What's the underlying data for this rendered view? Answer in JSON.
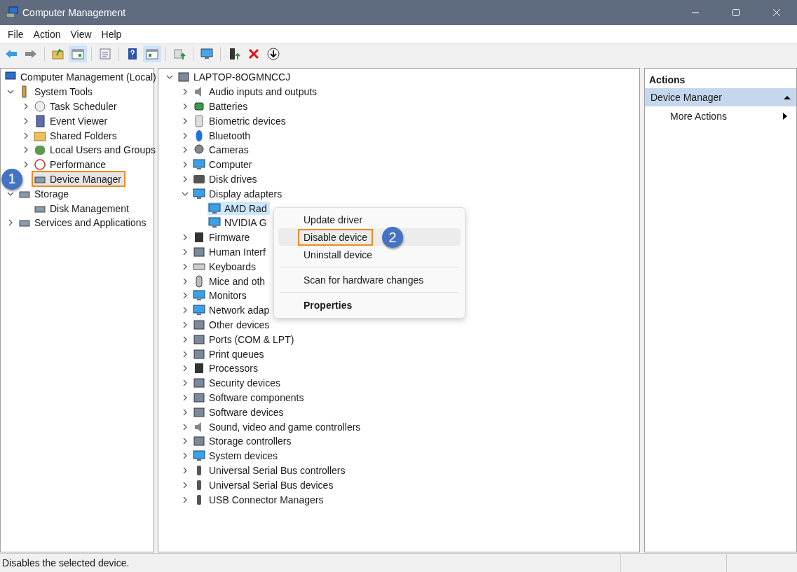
{
  "window": {
    "title": "Computer Management"
  },
  "menu_bar": [
    "File",
    "Action",
    "View",
    "Help"
  ],
  "toolbar": [
    {
      "pressed": false
    },
    {
      "pressed": false
    },
    {
      "pressed": false
    },
    {
      "pressed": true
    },
    {
      "pressed": false
    },
    {
      "pressed": false
    },
    {
      "pressed": true
    },
    {
      "pressed": false
    },
    {
      "pressed": false
    },
    {
      "pressed": false
    },
    {
      "pressed": false
    },
    {
      "pressed": false
    }
  ],
  "console_tree": {
    "root": {
      "label": "Computer Management (Local)",
      "selected": false,
      "children": [
        {
          "label": "System Tools",
          "selected": false,
          "expanded": true,
          "children": [
            {
              "label": "Task Scheduler",
              "selected": false,
              "expanded": false
            },
            {
              "label": "Event Viewer",
              "selected": false,
              "expanded": false
            },
            {
              "label": "Shared Folders",
              "selected": false,
              "expanded": false
            },
            {
              "label": "Local Users and Groups",
              "selected": false,
              "expanded": false
            },
            {
              "label": "Performance",
              "selected": false,
              "expanded": false
            },
            {
              "label": "Device Manager",
              "selected": true,
              "callout": "1"
            }
          ]
        },
        {
          "label": "Storage",
          "selected": false,
          "expanded": true,
          "children": [
            {
              "label": "Disk Management",
              "selected": false
            }
          ]
        },
        {
          "label": "Services and Applications",
          "selected": false,
          "expanded": false
        }
      ]
    }
  },
  "device_tree": {
    "root": {
      "label": "LAPTOP-8OGMNCCJ",
      "selected": false,
      "expanded": true,
      "children": [
        {
          "label": "Audio inputs and outputs",
          "selected": false,
          "expanded": false
        },
        {
          "label": "Batteries",
          "selected": false,
          "expanded": false
        },
        {
          "label": "Biometric devices",
          "selected": false,
          "expanded": false
        },
        {
          "label": "Bluetooth",
          "selected": false,
          "expanded": false
        },
        {
          "label": "Cameras",
          "selected": false,
          "expanded": false
        },
        {
          "label": "Computer",
          "selected": false,
          "expanded": false
        },
        {
          "label": "Disk drives",
          "selected": false,
          "expanded": false
        },
        {
          "label": "Display adapters",
          "selected": false,
          "expanded": true,
          "children": [
            {
              "label": "AMD Rad",
              "selected": true
            },
            {
              "label": "NVIDIA G",
              "selected": false
            }
          ]
        },
        {
          "label": "Firmware",
          "selected": false,
          "expanded": false
        },
        {
          "label": "Human Interf",
          "selected": false,
          "expanded": false
        },
        {
          "label": "Keyboards",
          "selected": false,
          "expanded": false
        },
        {
          "label": "Mice and oth",
          "selected": false,
          "expanded": false
        },
        {
          "label": "Monitors",
          "selected": false,
          "expanded": false
        },
        {
          "label": "Network adap",
          "selected": false,
          "expanded": false
        },
        {
          "label": "Other devices",
          "selected": false,
          "expanded": false
        },
        {
          "label": "Ports (COM & LPT)",
          "selected": false,
          "expanded": false
        },
        {
          "label": "Print queues",
          "selected": false,
          "expanded": false
        },
        {
          "label": "Processors",
          "selected": false,
          "expanded": false
        },
        {
          "label": "Security devices",
          "selected": false,
          "expanded": false
        },
        {
          "label": "Software components",
          "selected": false,
          "expanded": false
        },
        {
          "label": "Software devices",
          "selected": false,
          "expanded": false
        },
        {
          "label": "Sound, video and game controllers",
          "selected": false,
          "expanded": false
        },
        {
          "label": "Storage controllers",
          "selected": false,
          "expanded": false
        },
        {
          "label": "System devices",
          "selected": false,
          "expanded": false
        },
        {
          "label": "Universal Serial Bus controllers",
          "selected": false,
          "expanded": false
        },
        {
          "label": "Universal Serial Bus devices",
          "selected": false,
          "expanded": false
        },
        {
          "label": "USB Connector Managers",
          "selected": false,
          "expanded": false
        }
      ]
    }
  },
  "context_menu": {
    "items": [
      {
        "kind": "item",
        "label": "Update driver",
        "hover": false,
        "default": false
      },
      {
        "kind": "item",
        "label": "Disable device",
        "hover": true,
        "default": false,
        "callout": "2"
      },
      {
        "kind": "item",
        "label": "Uninstall device",
        "hover": false,
        "default": false
      },
      {
        "kind": "separator"
      },
      {
        "kind": "item",
        "label": "Scan for hardware changes",
        "hover": false,
        "default": false
      },
      {
        "kind": "separator"
      },
      {
        "kind": "item",
        "label": "Properties",
        "hover": false,
        "default": true
      }
    ]
  },
  "actions_pane": {
    "title": "Actions",
    "section": {
      "label": "Device Manager",
      "expanded": true
    },
    "items": [
      {
        "label": "More Actions"
      }
    ]
  },
  "status_bar": {
    "text": "Disables the selected device."
  }
}
